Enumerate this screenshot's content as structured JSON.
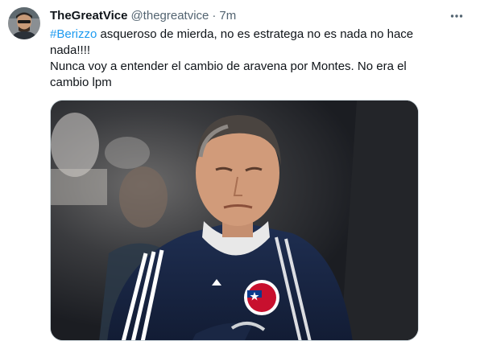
{
  "tweet": {
    "display_name": "TheGreatVice",
    "handle": "@thegreatvice",
    "separator": "·",
    "time": "7m",
    "hashtag": "#Berizzo",
    "line1_rest": " asqueroso de mierda, no es estratega no es nada no hace nada!!!!",
    "line2": "Nunca voy a entender el cambio de aravena por Montes. No era el cambio lpm"
  },
  "icons": {
    "more": "more-horizontal-icon",
    "avatar": "avatar-image",
    "media": "photo-man-in-tracksuit"
  },
  "colors": {
    "link": "#1d9bf0",
    "text": "#0f1419",
    "muted": "#536471",
    "border": "#cfd9de"
  }
}
